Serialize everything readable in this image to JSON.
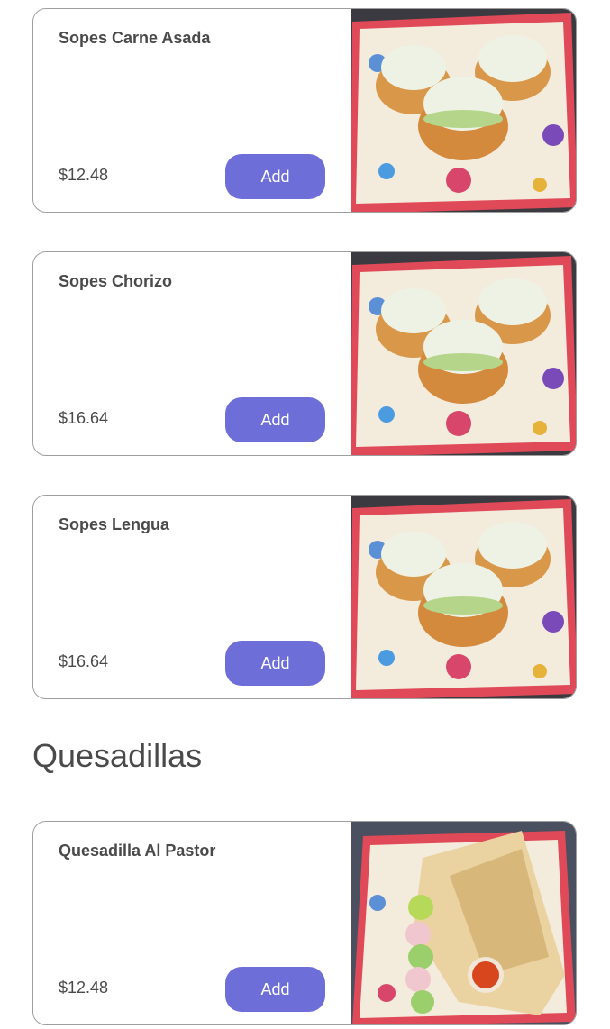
{
  "items": [
    {
      "name": "Sopes Carne Asada",
      "price": "$12.48",
      "add_label": "Add"
    },
    {
      "name": "Sopes Chorizo",
      "price": "$16.64",
      "add_label": "Add"
    },
    {
      "name": "Sopes Lengua",
      "price": "$16.64",
      "add_label": "Add"
    }
  ],
  "sections": [
    {
      "title": "Quesadillas",
      "items": [
        {
          "name": "Quesadilla Al Pastor",
          "price": "$12.48",
          "add_label": "Add"
        }
      ]
    }
  ],
  "colors": {
    "accent": "#6e6ed8",
    "border": "#9e9e9e",
    "text": "#4a4a4a"
  }
}
